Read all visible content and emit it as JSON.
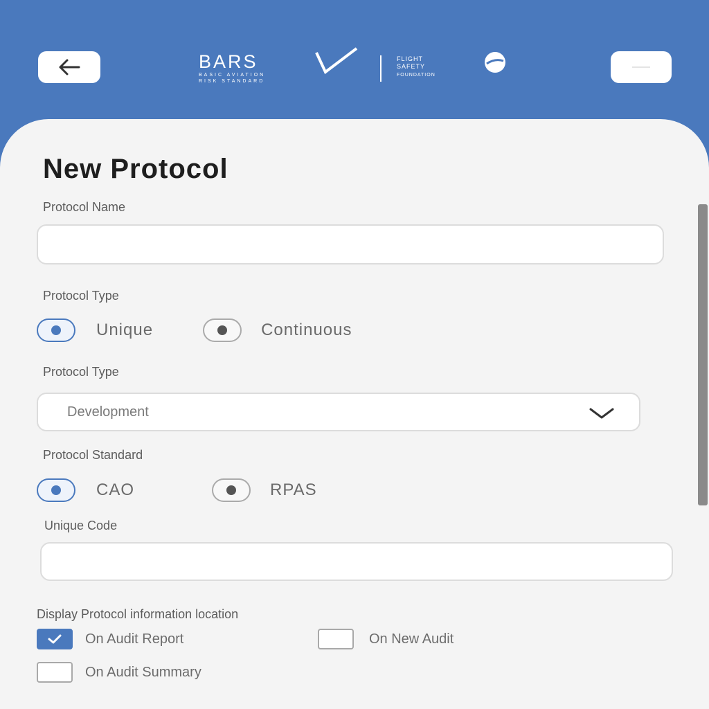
{
  "header": {
    "logo": {
      "brand": "BARS",
      "brand_sub_1": "BASIC AVIATION",
      "brand_sub_2": "RISK STANDARD",
      "partner_1": "FLIGHT",
      "partner_2": "SAFETY",
      "partner_3": "FOUNDATION"
    },
    "back_icon": "arrow-left-icon",
    "menu_icon": "menu-icon"
  },
  "form": {
    "title": "New Protocol",
    "protocol_name": {
      "label": "Protocol Name",
      "value": "",
      "placeholder": ""
    },
    "protocol_type_radio": {
      "label": "Protocol Type",
      "options": [
        "Unique",
        "Continuous"
      ],
      "selected": "Unique"
    },
    "protocol_type_select": {
      "label": "Protocol Type",
      "value": "Development",
      "icon": "chevron-down-icon"
    },
    "protocol_standard": {
      "label": "Protocol Standard",
      "options": [
        "CAO",
        "RPAS"
      ],
      "selected": "CAO"
    },
    "unique_code": {
      "label": "Unique Code",
      "value": "",
      "placeholder": ""
    },
    "display_location": {
      "label": "Display Protocol information location",
      "options": [
        {
          "label": "On Audit Report",
          "checked": true
        },
        {
          "label": "On New Audit",
          "checked": false
        },
        {
          "label": "On Audit Summary",
          "checked": false
        }
      ]
    }
  },
  "colors": {
    "accent": "#4a79bd",
    "panel": "#f4f4f4",
    "title": "#1e1e1e"
  }
}
